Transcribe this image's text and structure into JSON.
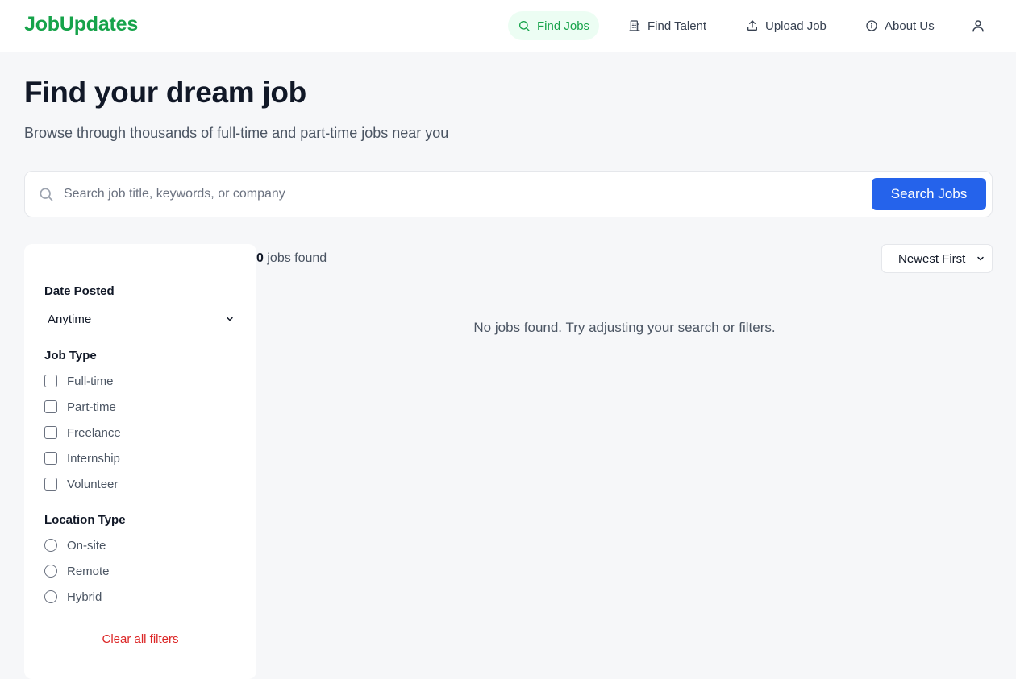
{
  "brand": {
    "name": "JobUpdates",
    "color": "#16a34a"
  },
  "nav": {
    "items": [
      {
        "label": "Find Jobs",
        "icon": "search-icon",
        "active": true
      },
      {
        "label": "Find Talent",
        "icon": "building-icon",
        "active": false
      },
      {
        "label": "Upload Job",
        "icon": "upload-icon",
        "active": false
      },
      {
        "label": "About Us",
        "icon": "info-icon",
        "active": false
      }
    ],
    "user_icon": "user-icon"
  },
  "hero": {
    "title": "Find your dream job",
    "subtitle": "Browse through thousands of full-time and part-time jobs near you"
  },
  "search": {
    "placeholder": "Search job title, keywords, or company",
    "value": "",
    "button_label": "Search Jobs",
    "button_color": "#2563eb"
  },
  "filters": {
    "date_posted": {
      "heading": "Date Posted",
      "selected": "Anytime"
    },
    "job_type": {
      "heading": "Job Type",
      "options": [
        "Full-time",
        "Part-time",
        "Freelance",
        "Internship",
        "Volunteer"
      ]
    },
    "location_type": {
      "heading": "Location Type",
      "options": [
        "On-site",
        "Remote",
        "Hybrid"
      ]
    },
    "clear_label": "Clear all filters"
  },
  "results": {
    "count": "0",
    "count_suffix": "jobs found",
    "sort_selected": "Newest First",
    "empty_message": "No jobs found. Try adjusting your search or filters."
  }
}
